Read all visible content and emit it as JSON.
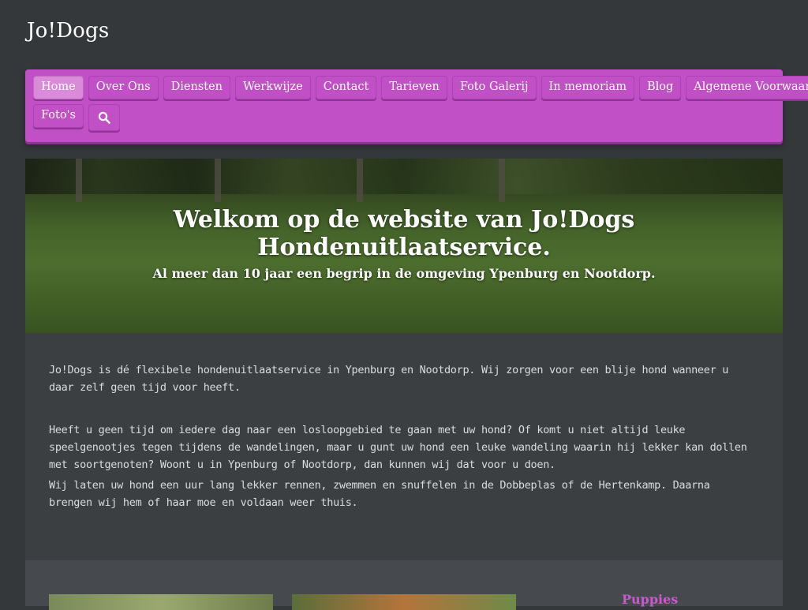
{
  "site": {
    "title": "Jo!Dogs"
  },
  "nav": {
    "row1": [
      "Home",
      "Over Ons",
      "Diensten",
      "Werkwijze",
      "Contact",
      "Tarieven",
      "Foto Galerij",
      "In memoriam",
      "Blog",
      "Algemene Voorwaarden"
    ],
    "row2": [
      "Foto's"
    ],
    "active": "Home",
    "search_icon": "search-icon"
  },
  "hero": {
    "title": "Welkom op de website van Jo!Dogs Hondenuitlaatservice.",
    "subtitle": "Al meer dan 10 jaar een begrip in de omgeving Ypenburg en Nootdorp."
  },
  "content": {
    "p1": "Jo!Dogs is dé flexibele hondenuitlaatservice in Ypenburg en Nootdorp. Wij zorgen voor een blije hond wanneer u daar zelf geen tijd voor heeft.",
    "p2": "Heeft u geen tijd om iedere dag naar een losloopgebied te gaan met uw hond? Of komt u niet altijd leuke speelgenootjes tegen tijdens de wandelingen, maar u gunt uw hond een leuke wandeling waarin hij lekker kan dollen met soortgenoten? Woont u in Ypenburg of Nootdorp, dan kunnen wij dat voor u doen.",
    "p3": "Wij laten uw hond een uur lang lekker rennen, zwemmen en snuffelen in de Dobbeplas of de Hertenkamp. Daarna brengen wij hem of haar moe en voldaan weer thuis."
  },
  "bottom": {
    "puppies_heading": "Puppies"
  },
  "colors": {
    "accent": "#c14fc5",
    "background": "#34383b",
    "content_bg": "#3b3f42"
  }
}
